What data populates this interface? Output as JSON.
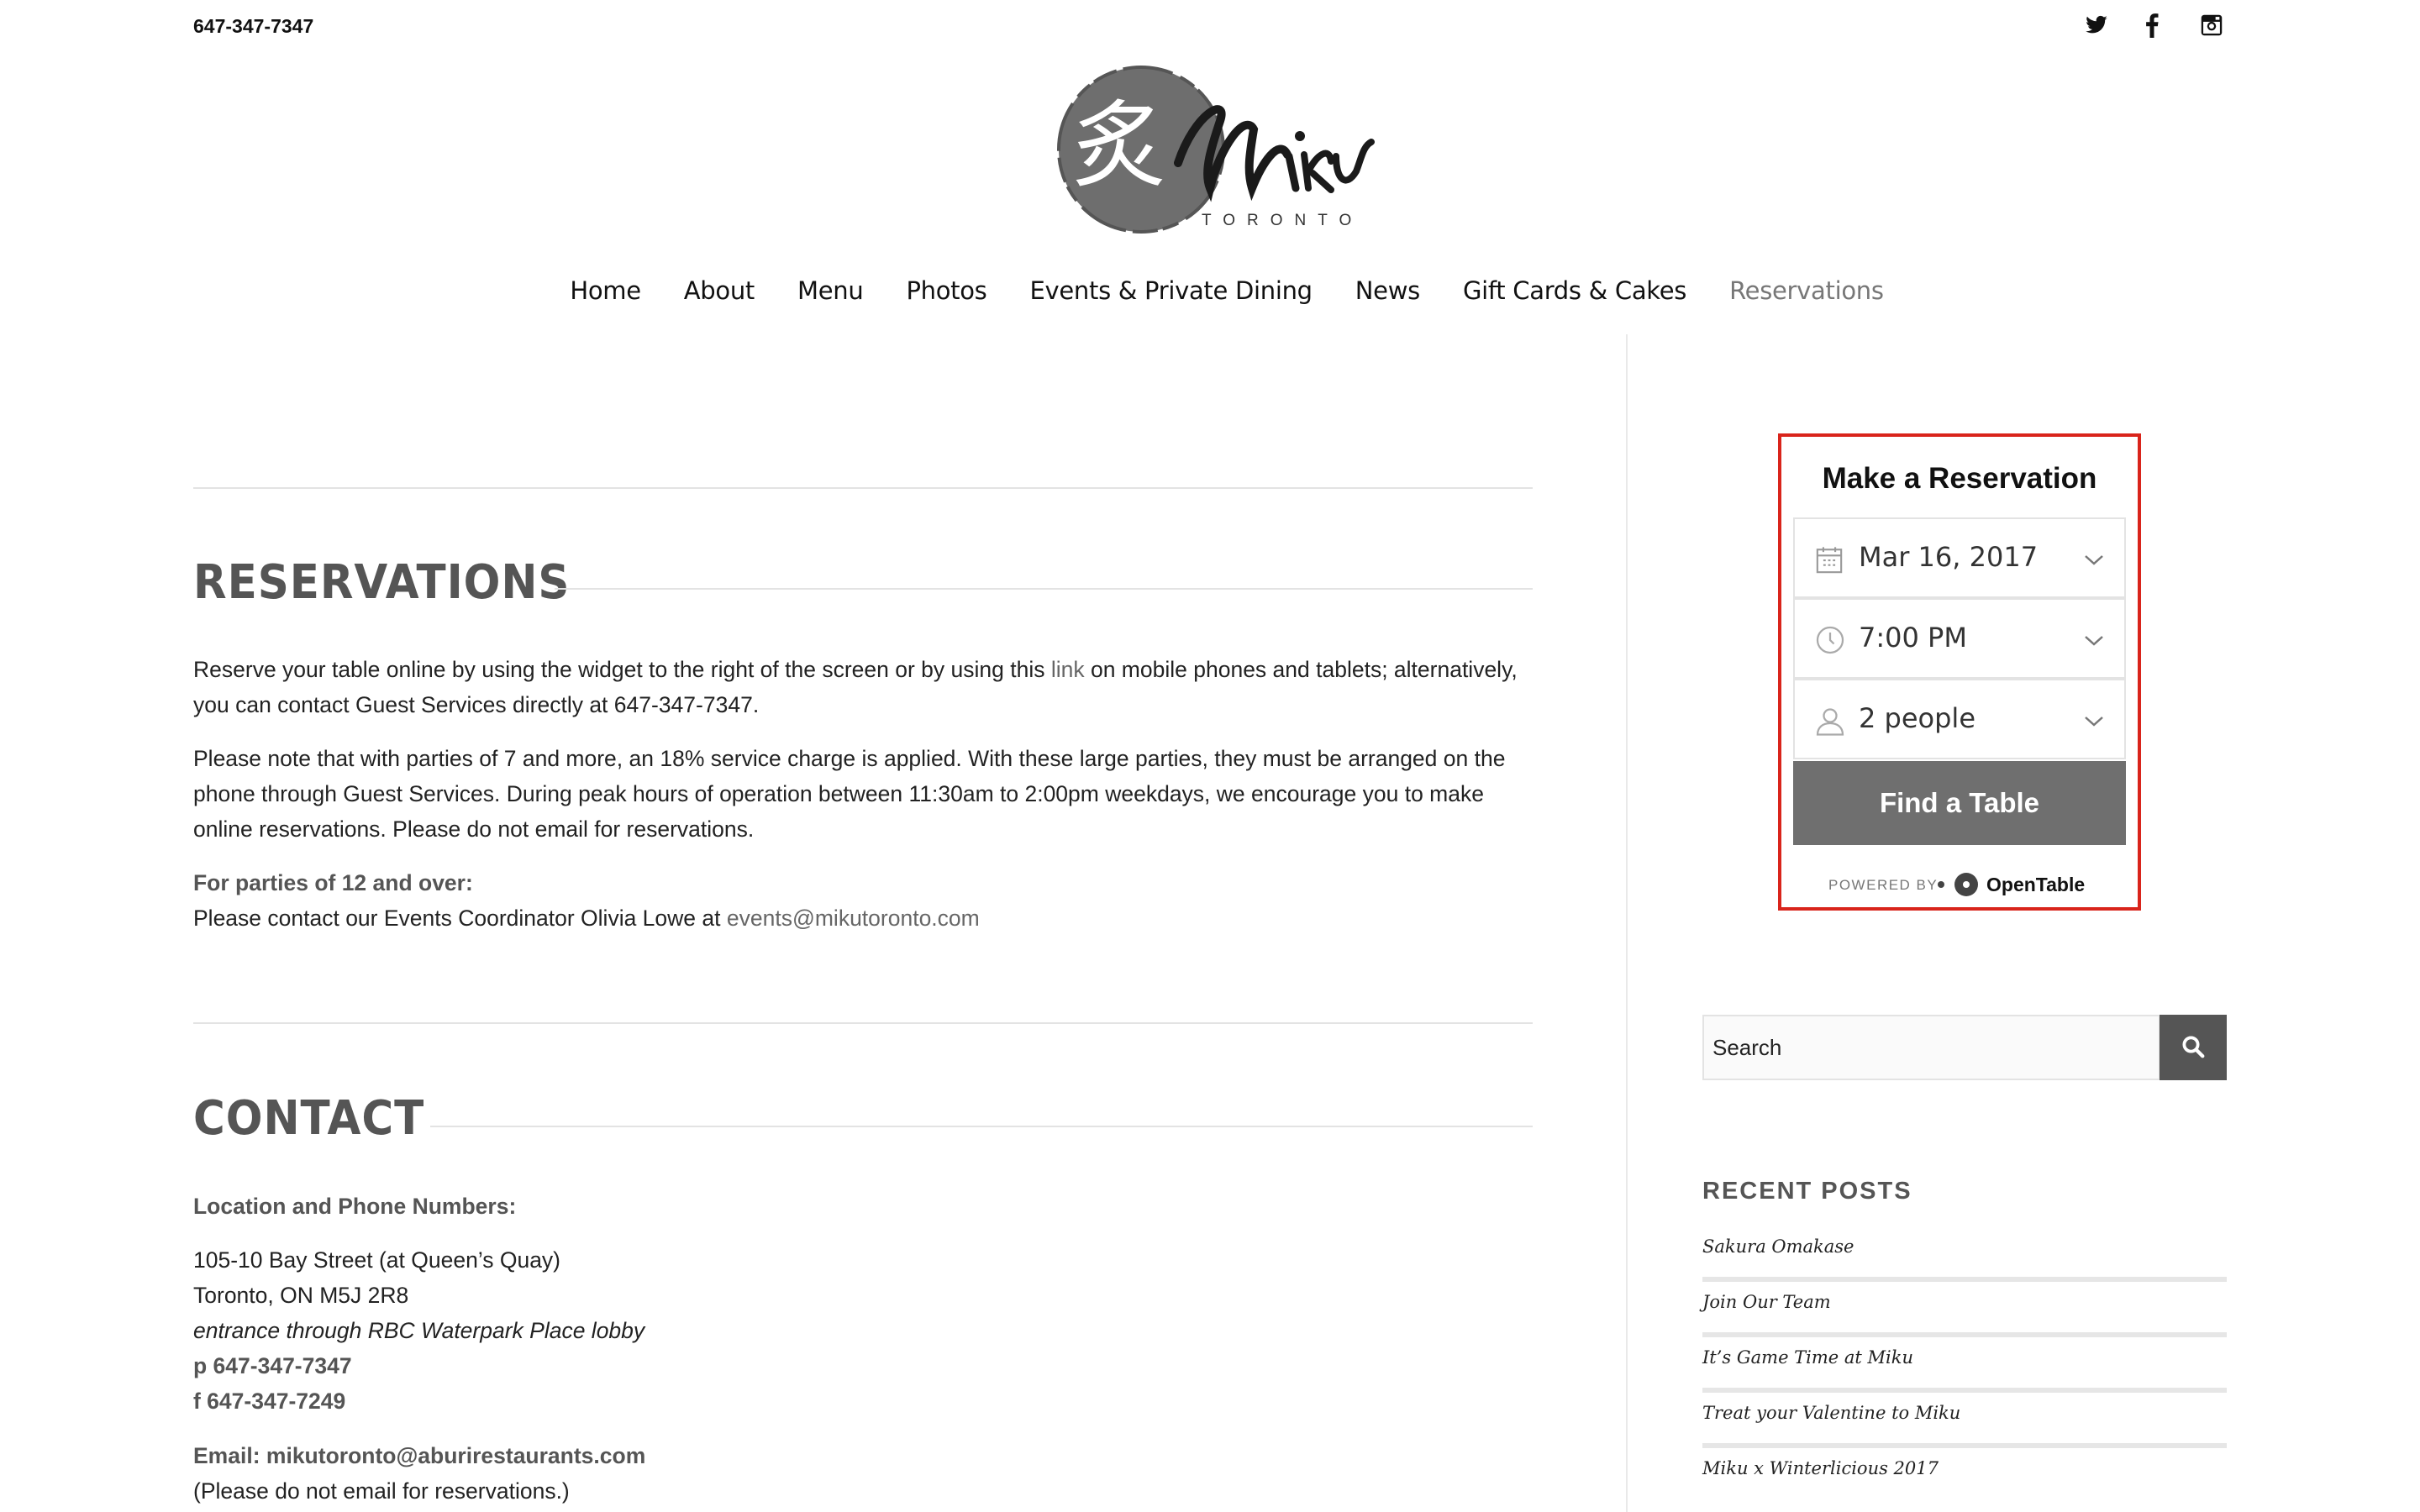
{
  "topbar": {
    "phone": "647-347-7347",
    "social": [
      "twitter-icon",
      "facebook-icon",
      "instagram-icon"
    ]
  },
  "logo": {
    "wordmark": "Miku",
    "tagline": "TORONTO",
    "kanji": "炙"
  },
  "nav": {
    "items": [
      {
        "label": "Home"
      },
      {
        "label": "About"
      },
      {
        "label": "Menu"
      },
      {
        "label": "Photos"
      },
      {
        "label": "Events & Private Dining"
      },
      {
        "label": "News"
      },
      {
        "label": "Gift Cards & Cakes"
      },
      {
        "label": "Reservations",
        "active": true
      }
    ]
  },
  "reservations": {
    "title": "RESERVATIONS",
    "p1_before": "Reserve your table online by using the widget to the right of the screen or by using this ",
    "p1_link": "link",
    "p1_after": " on mobile phones and tablets; alternatively, you can contact Guest Services directly at 647-347-7347.",
    "p2": "Please note that with parties of 7 and more, an 18% service charge is applied. With these large parties, they must be arranged on the phone through Guest Services. During peak hours of operation between 11:30am to 2:00pm weekdays, we encourage you to make online reservations. Please do not email for reservations.",
    "large_party_heading": "For parties of 12 and over:",
    "large_party_text": "Please contact our Events Coordinator Olivia Lowe at ",
    "large_party_email": "events@mikutoronto.com"
  },
  "contact": {
    "title": "CONTACT",
    "location_heading": "Location and Phone Numbers:",
    "address1": "105-10 Bay Street (at Queen’s Quay)",
    "address2": "Toronto, ON M5J 2R8",
    "entrance": "entrance through RBC Waterpark Place lobby",
    "phone": "p 647-347-7347",
    "fax": "f 647-347-7249",
    "email": "Email: mikutoronto@aburirestaurants.com",
    "email_note": "(Please do not email for reservations.)"
  },
  "widget": {
    "title": "Make a Reservation",
    "date": "Mar 16, 2017",
    "time": "7:00 PM",
    "party": "2 people",
    "button": "Find a Table",
    "powered_by": "POWERED BY",
    "brand": "OpenTable",
    "accent": "#d9241b"
  },
  "search": {
    "placeholder": "Search"
  },
  "recent_posts": {
    "title": "RECENT POSTS",
    "items": [
      "Sakura Omakase",
      "Join Our Team",
      "It’s Game Time at Miku",
      "Treat your Valentine to Miku",
      "Miku x Winterlicious 2017"
    ]
  }
}
